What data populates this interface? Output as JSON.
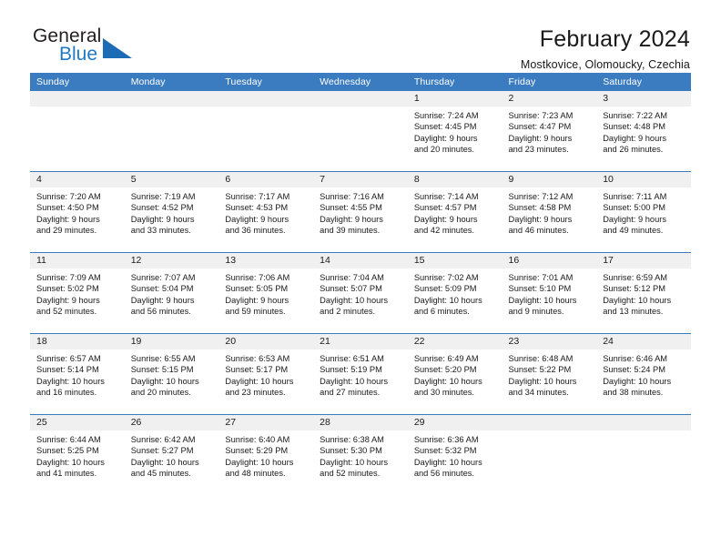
{
  "brand": {
    "name_top": "General",
    "name_bottom": "Blue",
    "triangle_color": "#1b6cb5",
    "blue_text_color": "#2079c4"
  },
  "header": {
    "title": "February 2024",
    "subtitle": "Mostkovice, Olomoucky, Czechia"
  },
  "theme": {
    "header_bar_color": "#3b7cc0",
    "daynum_band_color": "#f0f0f0",
    "text_color": "#1a1a1a"
  },
  "weekdays": [
    "Sunday",
    "Monday",
    "Tuesday",
    "Wednesday",
    "Thursday",
    "Friday",
    "Saturday"
  ],
  "weeks": [
    [
      {
        "day": "",
        "info": ""
      },
      {
        "day": "",
        "info": ""
      },
      {
        "day": "",
        "info": ""
      },
      {
        "day": "",
        "info": ""
      },
      {
        "day": "1",
        "info": "Sunrise: 7:24 AM\nSunset: 4:45 PM\nDaylight: 9 hours\nand 20 minutes."
      },
      {
        "day": "2",
        "info": "Sunrise: 7:23 AM\nSunset: 4:47 PM\nDaylight: 9 hours\nand 23 minutes."
      },
      {
        "day": "3",
        "info": "Sunrise: 7:22 AM\nSunset: 4:48 PM\nDaylight: 9 hours\nand 26 minutes."
      }
    ],
    [
      {
        "day": "4",
        "info": "Sunrise: 7:20 AM\nSunset: 4:50 PM\nDaylight: 9 hours\nand 29 minutes."
      },
      {
        "day": "5",
        "info": "Sunrise: 7:19 AM\nSunset: 4:52 PM\nDaylight: 9 hours\nand 33 minutes."
      },
      {
        "day": "6",
        "info": "Sunrise: 7:17 AM\nSunset: 4:53 PM\nDaylight: 9 hours\nand 36 minutes."
      },
      {
        "day": "7",
        "info": "Sunrise: 7:16 AM\nSunset: 4:55 PM\nDaylight: 9 hours\nand 39 minutes."
      },
      {
        "day": "8",
        "info": "Sunrise: 7:14 AM\nSunset: 4:57 PM\nDaylight: 9 hours\nand 42 minutes."
      },
      {
        "day": "9",
        "info": "Sunrise: 7:12 AM\nSunset: 4:58 PM\nDaylight: 9 hours\nand 46 minutes."
      },
      {
        "day": "10",
        "info": "Sunrise: 7:11 AM\nSunset: 5:00 PM\nDaylight: 9 hours\nand 49 minutes."
      }
    ],
    [
      {
        "day": "11",
        "info": "Sunrise: 7:09 AM\nSunset: 5:02 PM\nDaylight: 9 hours\nand 52 minutes."
      },
      {
        "day": "12",
        "info": "Sunrise: 7:07 AM\nSunset: 5:04 PM\nDaylight: 9 hours\nand 56 minutes."
      },
      {
        "day": "13",
        "info": "Sunrise: 7:06 AM\nSunset: 5:05 PM\nDaylight: 9 hours\nand 59 minutes."
      },
      {
        "day": "14",
        "info": "Sunrise: 7:04 AM\nSunset: 5:07 PM\nDaylight: 10 hours\nand 2 minutes."
      },
      {
        "day": "15",
        "info": "Sunrise: 7:02 AM\nSunset: 5:09 PM\nDaylight: 10 hours\nand 6 minutes."
      },
      {
        "day": "16",
        "info": "Sunrise: 7:01 AM\nSunset: 5:10 PM\nDaylight: 10 hours\nand 9 minutes."
      },
      {
        "day": "17",
        "info": "Sunrise: 6:59 AM\nSunset: 5:12 PM\nDaylight: 10 hours\nand 13 minutes."
      }
    ],
    [
      {
        "day": "18",
        "info": "Sunrise: 6:57 AM\nSunset: 5:14 PM\nDaylight: 10 hours\nand 16 minutes."
      },
      {
        "day": "19",
        "info": "Sunrise: 6:55 AM\nSunset: 5:15 PM\nDaylight: 10 hours\nand 20 minutes."
      },
      {
        "day": "20",
        "info": "Sunrise: 6:53 AM\nSunset: 5:17 PM\nDaylight: 10 hours\nand 23 minutes."
      },
      {
        "day": "21",
        "info": "Sunrise: 6:51 AM\nSunset: 5:19 PM\nDaylight: 10 hours\nand 27 minutes."
      },
      {
        "day": "22",
        "info": "Sunrise: 6:49 AM\nSunset: 5:20 PM\nDaylight: 10 hours\nand 30 minutes."
      },
      {
        "day": "23",
        "info": "Sunrise: 6:48 AM\nSunset: 5:22 PM\nDaylight: 10 hours\nand 34 minutes."
      },
      {
        "day": "24",
        "info": "Sunrise: 6:46 AM\nSunset: 5:24 PM\nDaylight: 10 hours\nand 38 minutes."
      }
    ],
    [
      {
        "day": "25",
        "info": "Sunrise: 6:44 AM\nSunset: 5:25 PM\nDaylight: 10 hours\nand 41 minutes."
      },
      {
        "day": "26",
        "info": "Sunrise: 6:42 AM\nSunset: 5:27 PM\nDaylight: 10 hours\nand 45 minutes."
      },
      {
        "day": "27",
        "info": "Sunrise: 6:40 AM\nSunset: 5:29 PM\nDaylight: 10 hours\nand 48 minutes."
      },
      {
        "day": "28",
        "info": "Sunrise: 6:38 AM\nSunset: 5:30 PM\nDaylight: 10 hours\nand 52 minutes."
      },
      {
        "day": "29",
        "info": "Sunrise: 6:36 AM\nSunset: 5:32 PM\nDaylight: 10 hours\nand 56 minutes."
      },
      {
        "day": "",
        "info": ""
      },
      {
        "day": "",
        "info": ""
      }
    ]
  ]
}
